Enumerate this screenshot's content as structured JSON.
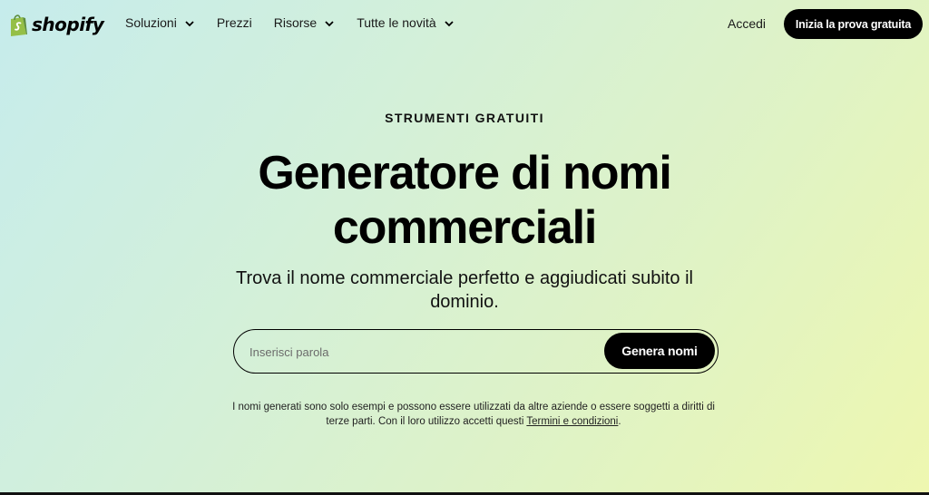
{
  "header": {
    "logo_text": "shopify",
    "nav": [
      {
        "label": "Soluzioni",
        "has_dropdown": true
      },
      {
        "label": "Prezzi",
        "has_dropdown": false
      },
      {
        "label": "Risorse",
        "has_dropdown": true
      },
      {
        "label": "Tutte le novità",
        "has_dropdown": true
      }
    ],
    "login_label": "Accedi",
    "cta_label": "Inizia la prova gratuita"
  },
  "hero": {
    "eyebrow": "STRUMENTI GRATUITI",
    "title_line1": "Generatore di nomi",
    "title_line2": "commerciali",
    "subtitle": "Trova il nome commerciale perfetto e aggiudicati subito il dominio."
  },
  "search": {
    "placeholder": "Inserisci parola",
    "value": "",
    "button_label": "Genera nomi"
  },
  "disclaimer": {
    "text": "I nomi generati sono solo esempi e possono essere utilizzati da altre aziende o essere soggetti a diritti di terze parti. Con il loro utilizzo accetti questi ",
    "link_label": "Termini e condizioni",
    "suffix": "."
  },
  "colors": {
    "brand_green": "#95bf47",
    "brand_dark_green": "#5e8e3e",
    "button_bg": "#000000",
    "button_text": "#ffffff"
  },
  "icons": {
    "logo": "shopify-bag-icon",
    "dropdown": "chevron-down-icon"
  }
}
